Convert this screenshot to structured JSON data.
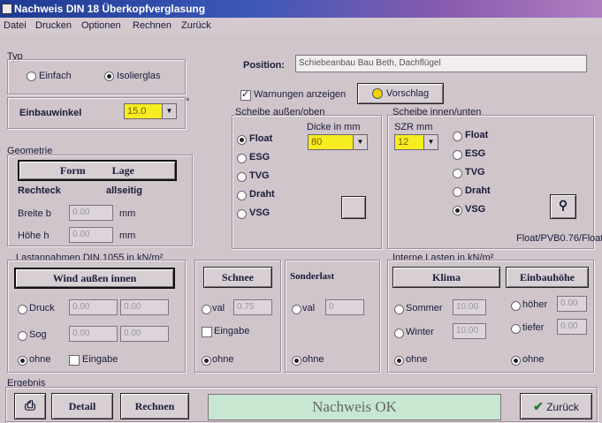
{
  "window": {
    "title": "Nachweis DIN 18 Überkopfverglasung"
  },
  "menu": [
    "Datei",
    "Drucken",
    "Optionen",
    "Rechnen",
    "Zurück"
  ],
  "typ": {
    "label": "Typ",
    "option1": "Einfach",
    "option2": "Isolierglas"
  },
  "einbauwinkel": {
    "label": "Einbauwinkel",
    "value": "15.0",
    "unit": "°"
  },
  "position": {
    "label": "Position:",
    "value": "Schiebeanbau Bau Beth, Dachflügel"
  },
  "warnungen": {
    "label": "Warnungen anzeigen",
    "vorschlag": "Vorschlag"
  },
  "scheibe_oben": {
    "label": "Scheibe außen/oben",
    "dicke_label": "Dicke in mm",
    "dicke_value": "80",
    "options": [
      "Float",
      "ESG",
      "TVG",
      "Draht",
      "VSG"
    ]
  },
  "scheibe_unten": {
    "label": "Scheibe innen/unten",
    "szr_label": "SZR mm",
    "szr_value": "12",
    "options": [
      "Float",
      "ESG",
      "TVG",
      "Draht",
      "VSG"
    ],
    "info": "Float/PVB0.76/Float"
  },
  "geometrie": {
    "label": "Geometrie",
    "form_btn": "Form",
    "lage_btn": "Lage",
    "shape": "Rechteck",
    "support": "allseitig",
    "breite_label": "Breite b",
    "breite_value": "0.00",
    "hoehe_label": "Höhe h",
    "hoehe_value": "0.00",
    "unit": "mm"
  },
  "lastannahmen": {
    "label": "Lastannahmen DIN 1055 in kN/m²",
    "wind_btn": "Wind außen innen",
    "druck": "Druck",
    "druck_v1": "0.00",
    "druck_v2": "0.00",
    "sog": "Sog",
    "sog_v1": "0.00",
    "sog_v2": "0.00",
    "ohne": "ohne",
    "eingabe": "Eingabe"
  },
  "schnee": {
    "btn": "Schnee",
    "val_label": "val",
    "val": "0.75",
    "eingabe": "Eingabe",
    "ohne": "ohne"
  },
  "sonderlast": {
    "label": "Sonderlast",
    "val_label": "val",
    "val": "0",
    "ohne": "ohne"
  },
  "interne_lasten": {
    "label": "Interne Lasten in kN/m²",
    "klima_btn": "Klima",
    "einbauhoehe_btn": "Einbauhöhe",
    "sommer": "Sommer",
    "sommer_val": "10.00",
    "winter": "Winter",
    "winter_val": "10.00",
    "ohne": "ohne",
    "hoeher": "höher",
    "hoeher_val": "0.00",
    "tiefer": "tiefer",
    "tiefer_val": "0.00",
    "ohne2": "ohne"
  },
  "footer": {
    "ergebnis": "Ergebnis",
    "detail_btn": "Detail",
    "rechnen_btn": "Rechnen",
    "status": "Nachweis OK",
    "zurueck_btn": "Zurück"
  }
}
